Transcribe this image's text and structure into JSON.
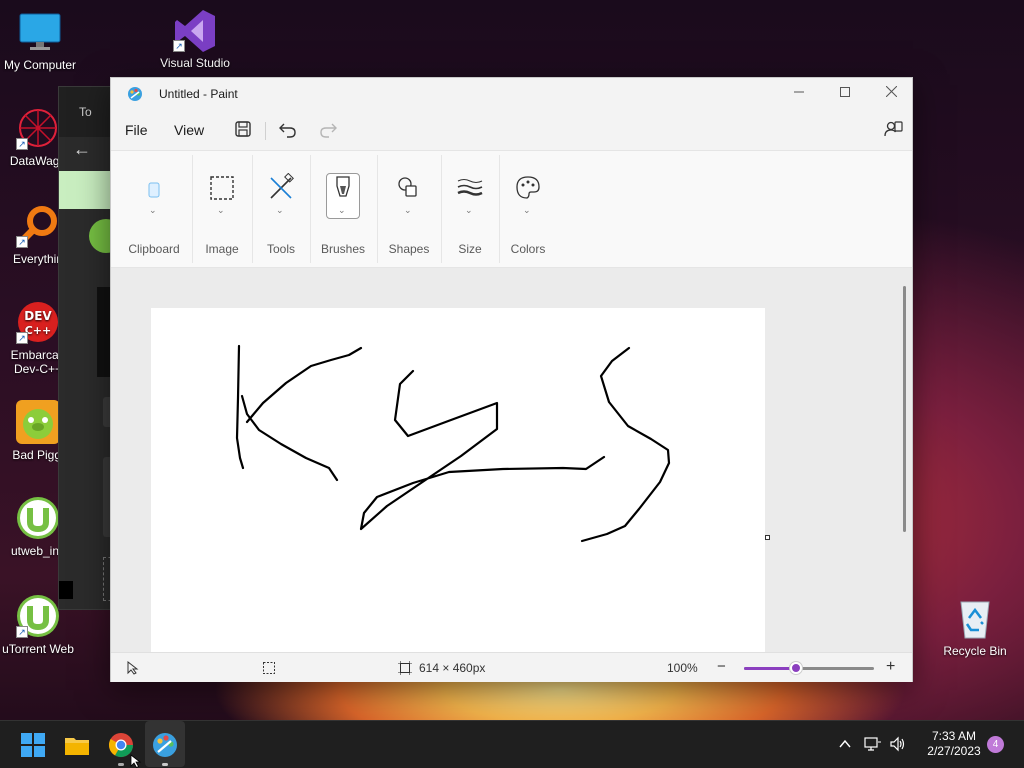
{
  "desktop": {
    "icons": [
      {
        "label": "My Computer",
        "icon": "monitor-icon"
      },
      {
        "label": "Visual Studio",
        "icon": "visual-studio-icon"
      },
      {
        "label": "DataWago",
        "icon": "datawago-icon"
      },
      {
        "label": "Everythin",
        "icon": "everything-search-icon"
      },
      {
        "label": "Embarcad",
        "label2": "Dev-C++",
        "icon": "devcpp-icon"
      },
      {
        "label": "Bad Piggi",
        "icon": "bad-piggies-icon"
      },
      {
        "label": "utweb_ins",
        "icon": "utorrent-icon"
      },
      {
        "label": "uTorrent Web",
        "icon": "utorrent-icon"
      },
      {
        "label": "Recycle Bin",
        "icon": "recycle-bin-icon"
      }
    ]
  },
  "background_window": {
    "tab_text": "To"
  },
  "paint": {
    "title": "Untitled - Paint",
    "menu": {
      "file": "File",
      "view": "View"
    },
    "ribbon": {
      "groups": [
        {
          "label": "Clipboard",
          "icon": "clipboard-icon"
        },
        {
          "label": "Image",
          "icon": "select-rectangle-icon"
        },
        {
          "label": "Tools",
          "icon": "tools-icon"
        },
        {
          "label": "Brushes",
          "icon": "brush-icon"
        },
        {
          "label": "Shapes",
          "icon": "shapes-icon"
        },
        {
          "label": "Size",
          "icon": "line-size-icon"
        },
        {
          "label": "Colors",
          "icon": "palette-icon"
        }
      ]
    },
    "status": {
      "canvas_size": "614 × 460px",
      "zoom": "100%",
      "zoom_minus": "−",
      "zoom_plus": "+",
      "zoom_level": 0.4
    }
  },
  "taskbar": {
    "apps": [
      "start-icon",
      "file-explorer-icon",
      "chrome-icon",
      "paint-icon"
    ],
    "time": "7:33 AM",
    "date": "2/27/2023",
    "notifications": "4"
  },
  "colors": {
    "accent": "#8b3fbf",
    "taskbar": "#1f1f1f"
  }
}
